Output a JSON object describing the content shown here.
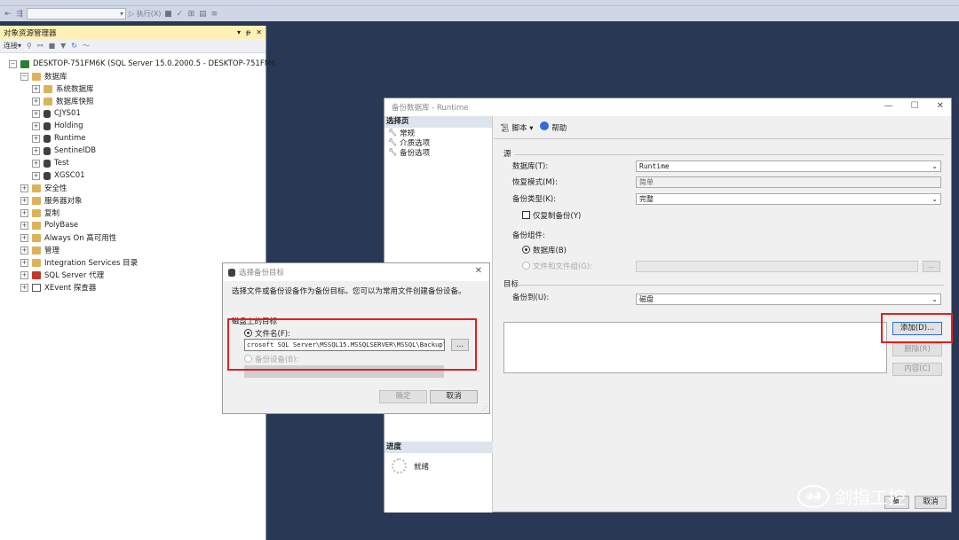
{
  "toolbar": {
    "combo_arrow": "▾",
    "execute_label": "▷ 执行(X)"
  },
  "object_explorer": {
    "title": "对象资源管理器",
    "title_controls": [
      "▾",
      "ᵽ",
      "✕"
    ],
    "connect_label": "连接",
    "server_node": "DESKTOP-751FM6K (SQL Server 15.0.2000.5 - DESKTOP-751FM6",
    "databases_label": "数据库",
    "db_children": [
      "系统数据库",
      "数据库快照",
      "CJYS01",
      "Holding",
      "Runtime",
      "SentinelDB",
      "Test",
      "XGSC01"
    ],
    "server_children": [
      "安全性",
      "服务器对象",
      "复制",
      "PolyBase",
      "Always On 高可用性",
      "管理",
      "Integration Services 目录",
      "SQL Server 代理",
      "XEvent 探查器"
    ]
  },
  "backup_window": {
    "title": "备份数据库 - Runtime",
    "select_page": "选择页",
    "pages": [
      "常规",
      "介质选项",
      "备份选项"
    ],
    "progress_header": "进度",
    "progress_status": "就绪",
    "script_label": "脚本",
    "help_label": "帮助",
    "source_label": "源",
    "database_label": "数据库(T):",
    "database_value": "Runtime",
    "recovery_label": "恢复模式(M):",
    "recovery_value": "简单",
    "backup_type_label": "备份类型(K):",
    "backup_type_value": "完整",
    "copy_only_label": "仅复制备份(Y)",
    "component_label": "备份组件:",
    "component_db": "数据库(B)",
    "component_files": "文件和文件组(G):",
    "dest_label": "目标",
    "backup_to_label": "备份到(U):",
    "backup_to_value": "磁盘",
    "add_button": "添加(D)...",
    "remove_button": "删除(R)",
    "contents_button": "内容(C)",
    "ok_fragment": "确",
    "cancel_fragment": "取消",
    "browse_label": "..."
  },
  "select_dialog": {
    "title": "选择备份目标",
    "instruction": "选择文件或备份设备作为备份目标。您可以为常用文件创建备份设备。",
    "disk_group": "磁盘上的目标",
    "file_name_label": "文件名(F):",
    "file_path": "crosoft SQL Server\\MSSQL15.MSSQLSERVER\\MSSQL\\Backup\\",
    "browse_label": "...",
    "backup_device_label": "备份设备(B):",
    "ok_button": "确定",
    "cancel_button": "取消"
  },
  "watermark": {
    "text": "剑指工控"
  }
}
